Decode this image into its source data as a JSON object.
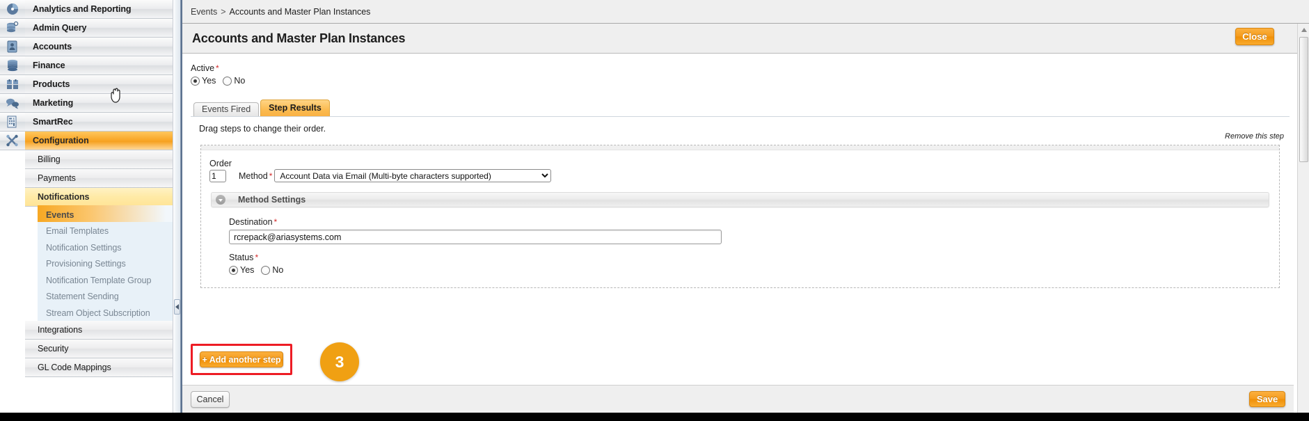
{
  "sidebar": {
    "primary_items": [
      {
        "label": "Analytics and Reporting",
        "icon": "pie-chart-icon"
      },
      {
        "label": "Admin Query",
        "icon": "database-search-icon"
      },
      {
        "label": "Accounts",
        "icon": "contact-card-icon"
      },
      {
        "label": "Finance",
        "icon": "stacked-coins-icon"
      },
      {
        "label": "Products",
        "icon": "boxes-icon"
      },
      {
        "label": "Marketing",
        "icon": "speech-bubbles-icon"
      },
      {
        "label": "SmartRec",
        "icon": "invoice-icon"
      },
      {
        "label": "Configuration",
        "icon": "tools-icon",
        "active": true
      }
    ],
    "config_items": [
      {
        "label": "Billing"
      },
      {
        "label": "Payments"
      },
      {
        "label": "Notifications",
        "active": true
      }
    ],
    "notification_items": [
      {
        "label": "Events",
        "active": true
      },
      {
        "label": "Email Templates"
      },
      {
        "label": "Notification Settings"
      },
      {
        "label": "Provisioning Settings"
      },
      {
        "label": "Notification Template Group"
      },
      {
        "label": "Statement Sending"
      },
      {
        "label": "Stream Object Subscription"
      }
    ],
    "trailing_items": [
      {
        "label": "Integrations"
      },
      {
        "label": "Security"
      },
      {
        "label": "GL Code Mappings"
      }
    ]
  },
  "breadcrumb": {
    "parent": "Events",
    "separator": ">",
    "current": "Accounts and Master Plan Instances"
  },
  "header": {
    "title": "Accounts and Master Plan Instances",
    "close_label": "Close"
  },
  "active_field": {
    "label": "Active",
    "required_mark": "*",
    "yes_label": "Yes",
    "no_label": "No",
    "selected": "Yes"
  },
  "tabs": [
    {
      "label": "Events Fired",
      "selected": false
    },
    {
      "label": "Step Results",
      "selected": true
    }
  ],
  "panel": {
    "drag_hint": "Drag steps to change their order.",
    "remove_step_label": "Remove this step"
  },
  "step": {
    "order_label": "Order",
    "order_value": "1",
    "method_label": "Method",
    "method_required": "*",
    "method_selected": "Account Data via Email (Multi-byte characters supported)",
    "method_options": [
      "Account Data via Email (Multi-byte characters supported)"
    ],
    "method_settings_title": "Method Settings",
    "collapse_icon": "chevron-down-circle-icon",
    "destination_label": "Destination",
    "destination_required": "*",
    "destination_value": "rcrepack@ariasystems.com",
    "status_label": "Status",
    "status_required": "*",
    "status_yes_label": "Yes",
    "status_no_label": "No",
    "status_selected": "Yes"
  },
  "actions": {
    "add_step_label": "+ Add another step",
    "step_badge_number": "3",
    "cancel_label": "Cancel",
    "save_label": "Save"
  },
  "colors": {
    "accent_orange": "#f5a01c",
    "highlight_red": "#ed1c24",
    "badge_orange": "#f0a013",
    "required_red": "#d32a2a",
    "tab_selected": "#fbbb51",
    "sidebar_active": "#f9a82b"
  }
}
